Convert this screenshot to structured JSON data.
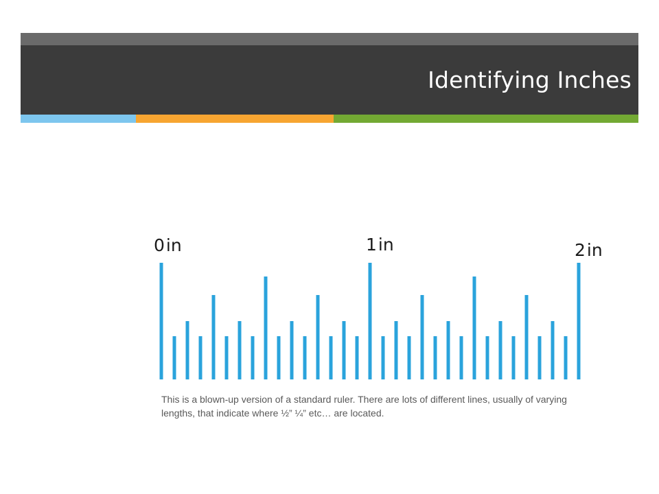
{
  "slide": {
    "title": "Identifying Inches",
    "caption": "This is a blown-up version of a standard ruler. There are lots of different lines, usually of varying lengths, that indicate where ½” ¼” etc… are located."
  },
  "colors": {
    "header_top": "#6a6a6a",
    "header_main": "#3b3b3b",
    "accent_blue": "#7dc6ee",
    "accent_orange": "#f7a531",
    "accent_green": "#73a933",
    "ruler_line": "#2aa3dc"
  },
  "ruler": {
    "inch_labels": [
      {
        "num": "0",
        "unit": "in"
      },
      {
        "num": "1",
        "unit": "in"
      },
      {
        "num": "2",
        "unit": "in"
      }
    ],
    "tick_pattern": [
      "inch",
      "sixteenth",
      "eighth",
      "sixteenth",
      "quarter",
      "sixteenth",
      "eighth",
      "sixteenth",
      "half",
      "sixteenth",
      "eighth",
      "sixteenth",
      "quarter",
      "sixteenth",
      "eighth",
      "sixteenth"
    ],
    "visible_inches": 2
  }
}
